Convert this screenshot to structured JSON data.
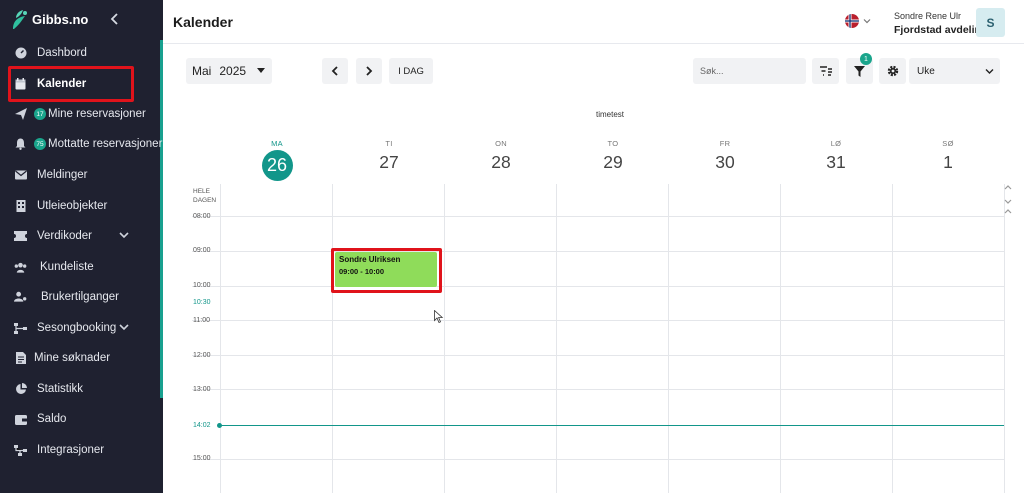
{
  "app": {
    "brand": "Gibbs.no",
    "page_title": "Kalender"
  },
  "sidebar": {
    "items": [
      {
        "label": "Dashbord",
        "icon": "dashboard-icon"
      },
      {
        "label": "Kalender",
        "icon": "calendar-icon",
        "active": true
      },
      {
        "label": "Mine reservasjoner",
        "icon": "send-icon",
        "badge": "17"
      },
      {
        "label": "Mottatte reservasjoner",
        "icon": "bell-icon",
        "badge": "75"
      },
      {
        "label": "Meldinger",
        "icon": "mail-icon"
      },
      {
        "label": "Utleieobjekter",
        "icon": "building-icon"
      },
      {
        "label": "Verdikoder",
        "icon": "ticket-icon",
        "expandable": true
      },
      {
        "label": "Kundeliste",
        "icon": "users-icon"
      },
      {
        "label": "Brukertilganger",
        "icon": "user-key-icon"
      },
      {
        "label": "Sesongbooking",
        "icon": "sitemap-icon",
        "expandable": true
      },
      {
        "label": "Mine søknader",
        "icon": "document-icon"
      },
      {
        "label": "Statistikk",
        "icon": "pie-chart-icon"
      },
      {
        "label": "Saldo",
        "icon": "wallet-icon"
      },
      {
        "label": "Integrasjoner",
        "icon": "integration-icon"
      }
    ]
  },
  "user": {
    "name": "Sondre Rene Ulr",
    "department": "Fjordstad avdeling",
    "initial": "S"
  },
  "toolbar": {
    "month": "Mai",
    "year": "2025",
    "today_label": "I DAG",
    "search_placeholder": "Søk...",
    "filter_count": "1",
    "view": "Uke"
  },
  "calendar": {
    "title": "timetest",
    "days": [
      {
        "name": "MA",
        "date": "26",
        "today": true
      },
      {
        "name": "TI",
        "date": "27"
      },
      {
        "name": "ON",
        "date": "28"
      },
      {
        "name": "TO",
        "date": "29"
      },
      {
        "name": "FR",
        "date": "30"
      },
      {
        "name": "LØ",
        "date": "31"
      },
      {
        "name": "SØ",
        "date": "1"
      }
    ],
    "allday_label_1": "HELE",
    "allday_label_2": "DAGEN",
    "times": [
      "08:00",
      "09:00",
      "10:00",
      "11:00",
      "12:00",
      "13:00",
      "14:00",
      "15:00"
    ],
    "marker_time": "10:30",
    "now_time": "14:02",
    "event": {
      "title": "Sondre Ulriksen",
      "time": "09:00 - 10:00",
      "color": "#8fdc5a"
    }
  },
  "colors": {
    "sidebar_bg": "#1f2130",
    "accent": "#12968a",
    "highlight": "#e0131b"
  }
}
